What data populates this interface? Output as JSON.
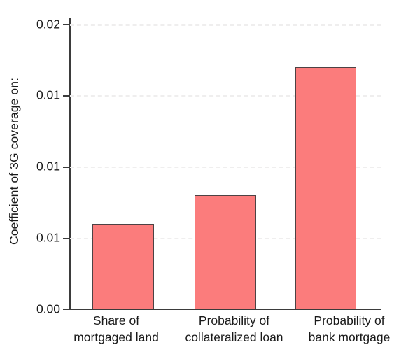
{
  "chart_data": {
    "type": "bar",
    "title": "",
    "subtitle": "",
    "xlabel": "",
    "ylabel": "Coefficient of 3G coverage on:",
    "categories": [
      "Share of mortgaged land",
      "Probability of collateralized loan",
      "Probability of bank mortgage"
    ],
    "category_lines": [
      [
        "Share of",
        "mortgaged land"
      ],
      [
        "Probability of",
        "collateralized loan"
      ],
      [
        "Probability of",
        "bank mortgage"
      ]
    ],
    "values": [
      0.006,
      0.008,
      0.017
    ],
    "ylim": [
      0.0,
      0.02
    ],
    "ytick_values": [
      0.0,
      0.005,
      0.01,
      0.015,
      0.02
    ],
    "ytick_labels": [
      "0.00",
      "0.01",
      "0.01",
      "0.01",
      "0.02"
    ],
    "grid": "horizontal-dashed",
    "legend": "none",
    "bar_color": "#fb7c7c",
    "bar_edge_color": "#4d4244",
    "grid_color": "#efeeee",
    "axis_color": "#3b3b3b",
    "background": "#ffffff"
  }
}
